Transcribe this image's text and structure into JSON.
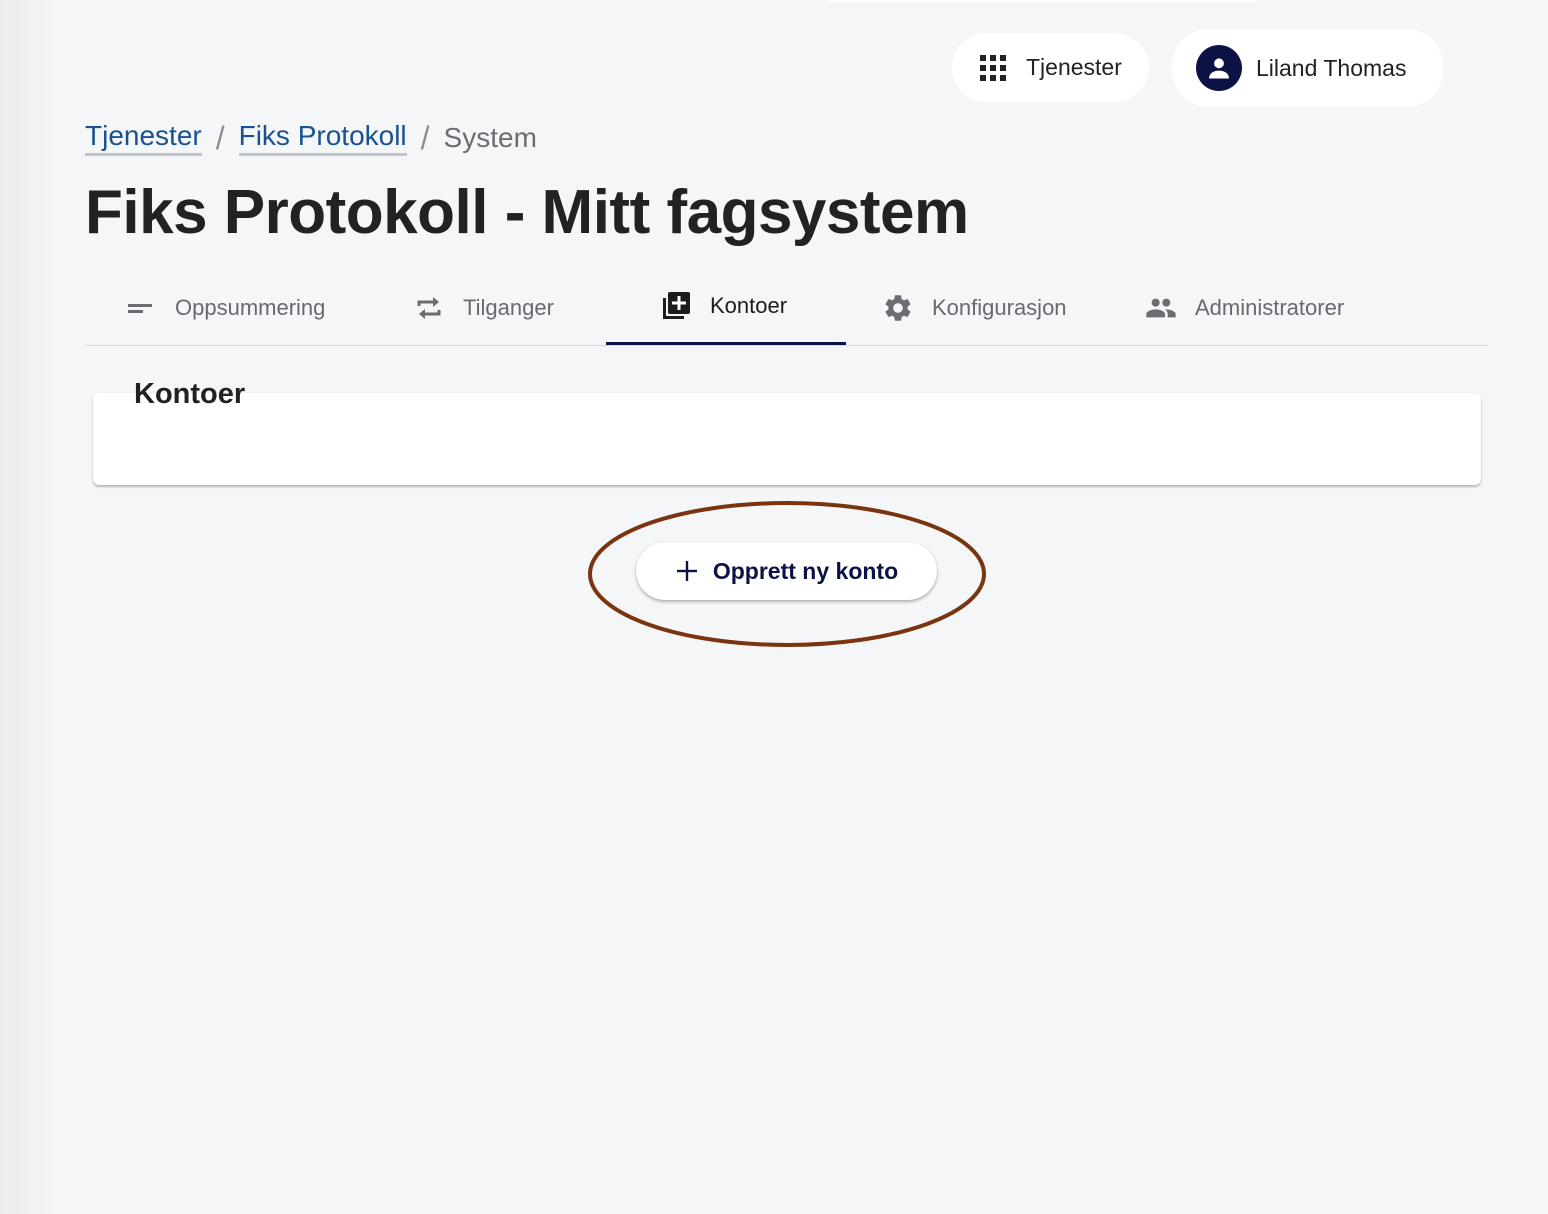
{
  "header": {
    "services_label": "Tjenester",
    "user_name": "Liland Thomas"
  },
  "breadcrumb": {
    "items": [
      "Tjenester",
      "Fiks Protokoll"
    ],
    "current": "System",
    "separator": "/"
  },
  "page": {
    "title": "Fiks Protokoll - Mitt fagsystem"
  },
  "tabs": [
    {
      "label": "Oppsummering",
      "icon": "short-text-icon",
      "active": false
    },
    {
      "label": "Tilganger",
      "icon": "repeat-icon",
      "active": false
    },
    {
      "label": "Kontoer",
      "icon": "library-add-icon",
      "active": true
    },
    {
      "label": "Konfigurasjon",
      "icon": "gear-icon",
      "active": false
    },
    {
      "label": "Administratorer",
      "icon": "people-icon",
      "active": false
    }
  ],
  "card": {
    "title": "Kontoer"
  },
  "actions": {
    "create_account_label": "Opprett ny konto"
  },
  "colors": {
    "background": "#f5f6f8",
    "brand_navy": "#0d1245",
    "link_blue": "#1a5290",
    "highlight_brown": "#7a3510"
  }
}
